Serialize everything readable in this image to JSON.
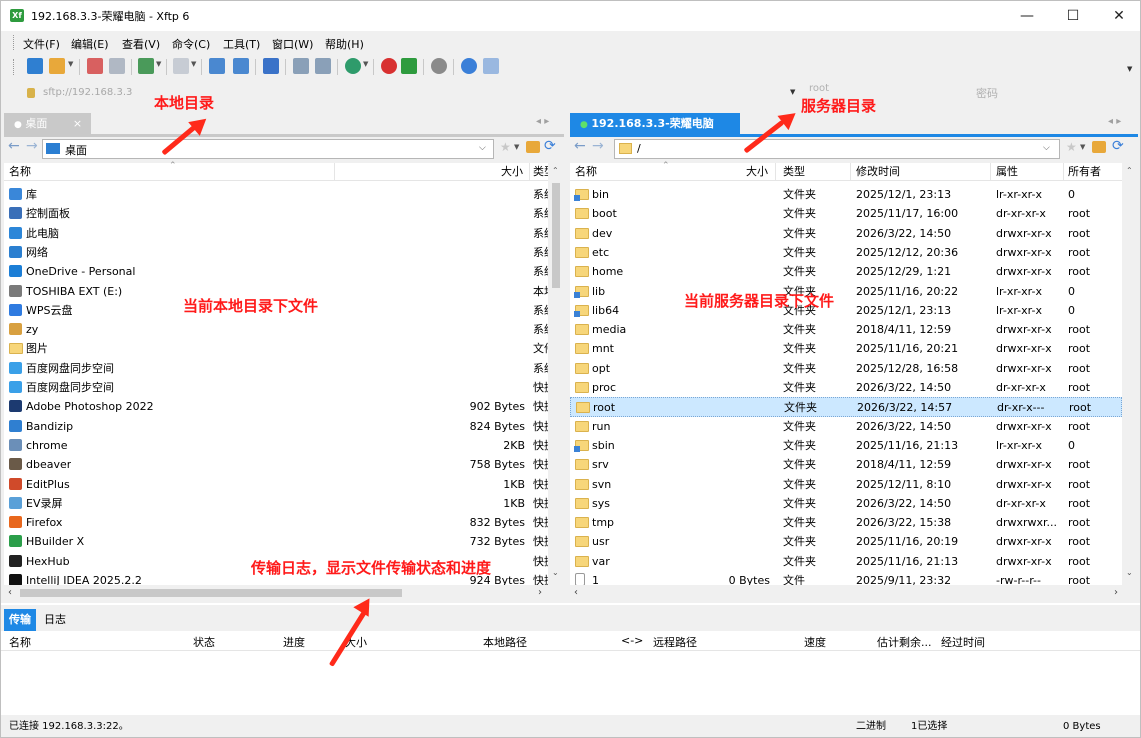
{
  "window": {
    "title": "192.168.3.3-荣耀电脑 - Xftp 6",
    "icon_label": "Xf",
    "controls": [
      "—",
      "☐",
      "✕"
    ]
  },
  "menu": [
    "文件(F)",
    "编辑(E)",
    "查看(V)",
    "命令(C)",
    "工具(T)",
    "窗口(W)",
    "帮助(H)"
  ],
  "address": {
    "url": "sftp://192.168.3.3",
    "user": "root",
    "password_placeholder": "密码"
  },
  "local": {
    "tab_label": "桌面",
    "tab_close": "×",
    "path": "桌面",
    "columns": [
      "名称",
      "大小",
      "类型"
    ],
    "files": [
      {
        "name": "库",
        "size": "",
        "type": "系统",
        "icon": "library-icon",
        "color": "#3a87d9"
      },
      {
        "name": "控制面板",
        "size": "",
        "type": "系统",
        "icon": "control-panel-icon",
        "color": "#3a6fb8"
      },
      {
        "name": "此电脑",
        "size": "",
        "type": "系统",
        "icon": "computer-icon",
        "color": "#2c86d8"
      },
      {
        "name": "网络",
        "size": "",
        "type": "系统",
        "icon": "network-icon",
        "color": "#2b7fd0"
      },
      {
        "name": "OneDrive - Personal",
        "size": "",
        "type": "系统",
        "icon": "onedrive-icon",
        "color": "#1c7ed6"
      },
      {
        "name": "TOSHIBA EXT (E:)",
        "size": "",
        "type": "本地",
        "icon": "drive-icon",
        "color": "#7a7a7a"
      },
      {
        "name": "WPS云盘",
        "size": "",
        "type": "系统",
        "icon": "wps-cloud-icon",
        "color": "#2f7be0"
      },
      {
        "name": "zy",
        "size": "",
        "type": "系统",
        "icon": "user-icon",
        "color": "#d8a040"
      },
      {
        "name": "图片",
        "size": "",
        "type": "文件",
        "icon": "folder-icon",
        "color": "#f7d67a"
      },
      {
        "name": "百度网盘同步空间",
        "size": "",
        "type": "系统",
        "icon": "baidu-netdisk-icon",
        "color": "#3aa0e8"
      },
      {
        "name": "百度网盘同步空间",
        "size": "",
        "type": "快捷",
        "icon": "baidu-netdisk-icon",
        "color": "#3aa0e8"
      },
      {
        "name": "Adobe Photoshop 2022",
        "size": "902 Bytes",
        "type": "快捷",
        "icon": "photoshop-icon",
        "color": "#1c3a70"
      },
      {
        "name": "Bandizip",
        "size": "824 Bytes",
        "type": "快捷",
        "icon": "bandizip-icon",
        "color": "#2f7fd1"
      },
      {
        "name": "chrome",
        "size": "2KB",
        "type": "快捷",
        "icon": "shortcut-icon",
        "color": "#6b8fb8"
      },
      {
        "name": "dbeaver",
        "size": "758 Bytes",
        "type": "快捷",
        "icon": "dbeaver-icon",
        "color": "#6a5a48"
      },
      {
        "name": "EditPlus",
        "size": "1KB",
        "type": "快捷",
        "icon": "editplus-icon",
        "color": "#d04a2a"
      },
      {
        "name": "EV录屏",
        "size": "1KB",
        "type": "快捷",
        "icon": "ev-recorder-icon",
        "color": "#5aa0d8"
      },
      {
        "name": "Firefox",
        "size": "832 Bytes",
        "type": "快捷",
        "icon": "firefox-icon",
        "color": "#e8671d"
      },
      {
        "name": "HBuilder X",
        "size": "732 Bytes",
        "type": "快捷",
        "icon": "hbuilder-icon",
        "color": "#2b9e4a"
      },
      {
        "name": "HexHub",
        "size": "",
        "type": "快捷",
        "icon": "hexhub-icon",
        "color": "#222222"
      },
      {
        "name": "IntelliJ IDEA 2025.2.2",
        "size": "924 Bytes",
        "type": "快捷",
        "icon": "intellij-icon",
        "color": "#111111"
      }
    ]
  },
  "remote": {
    "tab_label": "192.168.3.3-荣耀电脑",
    "tab_close": "×",
    "path": "/",
    "columns": [
      "名称",
      "大小",
      "类型",
      "修改时间",
      "属性",
      "所有者"
    ],
    "files": [
      {
        "name": "bin",
        "size": "",
        "type": "文件夹",
        "mtime": "2025/12/1, 23:13",
        "attr": "lr-xr-xr-x",
        "owner": "0",
        "link": true
      },
      {
        "name": "boot",
        "size": "",
        "type": "文件夹",
        "mtime": "2025/11/17, 16:00",
        "attr": "dr-xr-xr-x",
        "owner": "root"
      },
      {
        "name": "dev",
        "size": "",
        "type": "文件夹",
        "mtime": "2026/3/22, 14:50",
        "attr": "drwxr-xr-x",
        "owner": "root"
      },
      {
        "name": "etc",
        "size": "",
        "type": "文件夹",
        "mtime": "2025/12/12, 20:36",
        "attr": "drwxr-xr-x",
        "owner": "root"
      },
      {
        "name": "home",
        "size": "",
        "type": "文件夹",
        "mtime": "2025/12/29, 1:21",
        "attr": "drwxr-xr-x",
        "owner": "root"
      },
      {
        "name": "lib",
        "size": "",
        "type": "文件夹",
        "mtime": "2025/11/16, 20:22",
        "attr": "lr-xr-xr-x",
        "owner": "0",
        "link": true
      },
      {
        "name": "lib64",
        "size": "",
        "type": "文件夹",
        "mtime": "2025/12/1, 23:13",
        "attr": "lr-xr-xr-x",
        "owner": "0",
        "link": true
      },
      {
        "name": "media",
        "size": "",
        "type": "文件夹",
        "mtime": "2018/4/11, 12:59",
        "attr": "drwxr-xr-x",
        "owner": "root"
      },
      {
        "name": "mnt",
        "size": "",
        "type": "文件夹",
        "mtime": "2025/11/16, 20:21",
        "attr": "drwxr-xr-x",
        "owner": "root"
      },
      {
        "name": "opt",
        "size": "",
        "type": "文件夹",
        "mtime": "2025/12/28, 16:58",
        "attr": "drwxr-xr-x",
        "owner": "root"
      },
      {
        "name": "proc",
        "size": "",
        "type": "文件夹",
        "mtime": "2026/3/22, 14:50",
        "attr": "dr-xr-xr-x",
        "owner": "root"
      },
      {
        "name": "root",
        "size": "",
        "type": "文件夹",
        "mtime": "2026/3/22, 14:57",
        "attr": "dr-xr-x---",
        "owner": "root",
        "selected": true
      },
      {
        "name": "run",
        "size": "",
        "type": "文件夹",
        "mtime": "2026/3/22, 14:50",
        "attr": "drwxr-xr-x",
        "owner": "root"
      },
      {
        "name": "sbin",
        "size": "",
        "type": "文件夹",
        "mtime": "2025/11/16, 21:13",
        "attr": "lr-xr-xr-x",
        "owner": "0",
        "link": true
      },
      {
        "name": "srv",
        "size": "",
        "type": "文件夹",
        "mtime": "2018/4/11, 12:59",
        "attr": "drwxr-xr-x",
        "owner": "root"
      },
      {
        "name": "svn",
        "size": "",
        "type": "文件夹",
        "mtime": "2025/12/11, 8:10",
        "attr": "drwxr-xr-x",
        "owner": "root"
      },
      {
        "name": "sys",
        "size": "",
        "type": "文件夹",
        "mtime": "2026/3/22, 14:50",
        "attr": "dr-xr-xr-x",
        "owner": "root"
      },
      {
        "name": "tmp",
        "size": "",
        "type": "文件夹",
        "mtime": "2026/3/22, 15:38",
        "attr": "drwxrwxr...",
        "owner": "root"
      },
      {
        "name": "usr",
        "size": "",
        "type": "文件夹",
        "mtime": "2025/11/16, 20:19",
        "attr": "drwxr-xr-x",
        "owner": "root"
      },
      {
        "name": "var",
        "size": "",
        "type": "文件夹",
        "mtime": "2025/11/16, 21:13",
        "attr": "drwxr-xr-x",
        "owner": "root"
      },
      {
        "name": "1",
        "size": "0 Bytes",
        "type": "文件",
        "mtime": "2025/9/11, 23:32",
        "attr": "-rw-r--r--",
        "owner": "root",
        "file": true
      }
    ]
  },
  "transfer": {
    "tabs": [
      "传输",
      "日志"
    ],
    "columns": [
      "名称",
      "状态",
      "进度",
      "大小",
      "本地路径",
      "<->",
      "远程路径",
      "速度",
      "估计剩余...",
      "经过时间"
    ]
  },
  "status": {
    "connection": "已连接 192.168.3.3:22。",
    "mode": "二进制",
    "selected": "1已选择",
    "size": "0 Bytes"
  },
  "annotations": {
    "local_dir": "本地目录",
    "remote_dir": "服务器目录",
    "local_files": "当前本地目录下文件",
    "remote_files": "当前服务器目录下文件",
    "transfer_log": "传输日志，显示文件传输状态和进度"
  },
  "colors": {
    "accent": "#0a64c8",
    "active_tab": "#1e88e5",
    "annotation": "#ff1a1a",
    "selection": "#cce8ff"
  }
}
